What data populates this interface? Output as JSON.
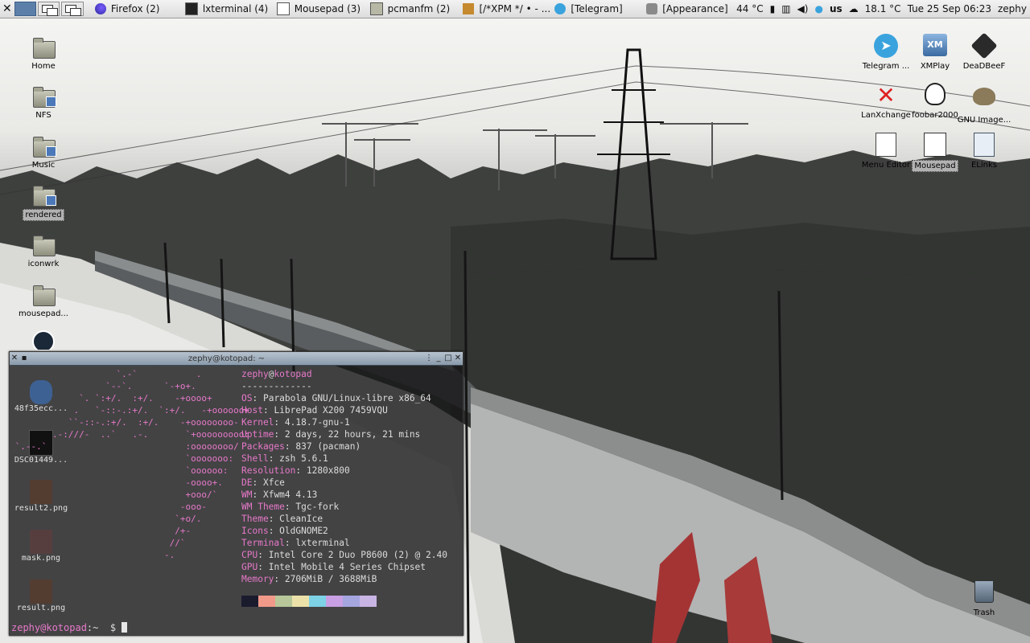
{
  "panel": {
    "tasks": [
      {
        "label": "Firefox (2)",
        "icon": "firefox-icon"
      },
      {
        "label": "lxterminal (4)",
        "icon": "terminal-icon"
      },
      {
        "label": "Mousepad (3)",
        "icon": "mousepad-icon"
      },
      {
        "label": "pcmanfm (2)",
        "icon": "folder-icon"
      },
      {
        "label": "[/*XPM */ • - ...",
        "icon": "gimp-icon"
      },
      {
        "label": "[Telegram]",
        "icon": "telegram-icon"
      },
      {
        "label": "[Appearance]",
        "icon": "appearance-icon"
      }
    ],
    "temperature": "44 °C",
    "keyboard": "us",
    "weather": "18.1 °C",
    "clock": "Tue 25 Sep 06:23",
    "user": "zephy"
  },
  "desktop_left": [
    {
      "label": "Home"
    },
    {
      "label": "NFS"
    },
    {
      "label": "Music"
    },
    {
      "label": "rendered"
    },
    {
      "label": "iconwrk"
    },
    {
      "label": "mousepad..."
    }
  ],
  "desktop_left_behind": [
    {
      "label": "48f35ecc..."
    },
    {
      "label": "DSC01449..."
    },
    {
      "label": "result2.png"
    },
    {
      "label": "mask.png"
    },
    {
      "label": "result.png"
    }
  ],
  "desktop_right": [
    {
      "label": "Telegram ...",
      "icon": "telegram-icon"
    },
    {
      "label": "XMPlay",
      "icon": "xmplay-icon"
    },
    {
      "label": "DeaDBeeF",
      "icon": "deadbeef-icon"
    },
    {
      "label": "LanXchange",
      "icon": "lanxchange-icon"
    },
    {
      "label": "foobar2000",
      "icon": "foobar-icon"
    },
    {
      "label": "GNU Image...",
      "icon": "gimp-icon"
    },
    {
      "label": "Menu Editor",
      "icon": "menu-editor-icon"
    },
    {
      "label": "Mousepad",
      "icon": "mousepad-icon"
    },
    {
      "label": "ELinks",
      "icon": "elinks-icon"
    }
  ],
  "trash": {
    "label": "Trash"
  },
  "terminal": {
    "title": "zephy@kotopad: ~",
    "user": "zephy",
    "at": "@",
    "host": "kotopad",
    "separator": "-------------",
    "info": [
      {
        "k": "OS",
        "v": "Parabola GNU/Linux-libre x86_64"
      },
      {
        "k": "Host",
        "v": "LibrePad X200 7459VQU"
      },
      {
        "k": "Kernel",
        "v": "4.18.7-gnu-1"
      },
      {
        "k": "Uptime",
        "v": "2 days, 22 hours, 21 mins"
      },
      {
        "k": "Packages",
        "v": "837 (pacman)"
      },
      {
        "k": "Shell",
        "v": "zsh 5.6.1"
      },
      {
        "k": "Resolution",
        "v": "1280x800"
      },
      {
        "k": "DE",
        "v": "Xfce"
      },
      {
        "k": "WM",
        "v": "Xfwm4 4.13"
      },
      {
        "k": "WM Theme",
        "v": "Tgc-fork"
      },
      {
        "k": "Theme",
        "v": "CleanIce"
      },
      {
        "k": "Icons",
        "v": "OldGNOME2"
      },
      {
        "k": "Terminal",
        "v": "lxterminal"
      },
      {
        "k": "CPU",
        "v": "Intel Core 2 Duo P8600 (2) @ 2.40"
      },
      {
        "k": "GPU",
        "v": "Intel Mobile 4 Series Chipset"
      },
      {
        "k": "Memory",
        "v": "2706MiB / 3688MiB"
      }
    ],
    "palette": [
      "#1b1b2e",
      "#f19a8a",
      "#b7c79a",
      "#ece2a9",
      "#7dd2e6",
      "#c8a0e3",
      "#a5a5e0",
      "#c9b5e4"
    ],
    "prompt_user": "zephy@kotopad",
    "prompt_rest": ":~  $ "
  },
  "colors": {
    "accent": "#e779c9",
    "panel": "#e6e6e6"
  }
}
